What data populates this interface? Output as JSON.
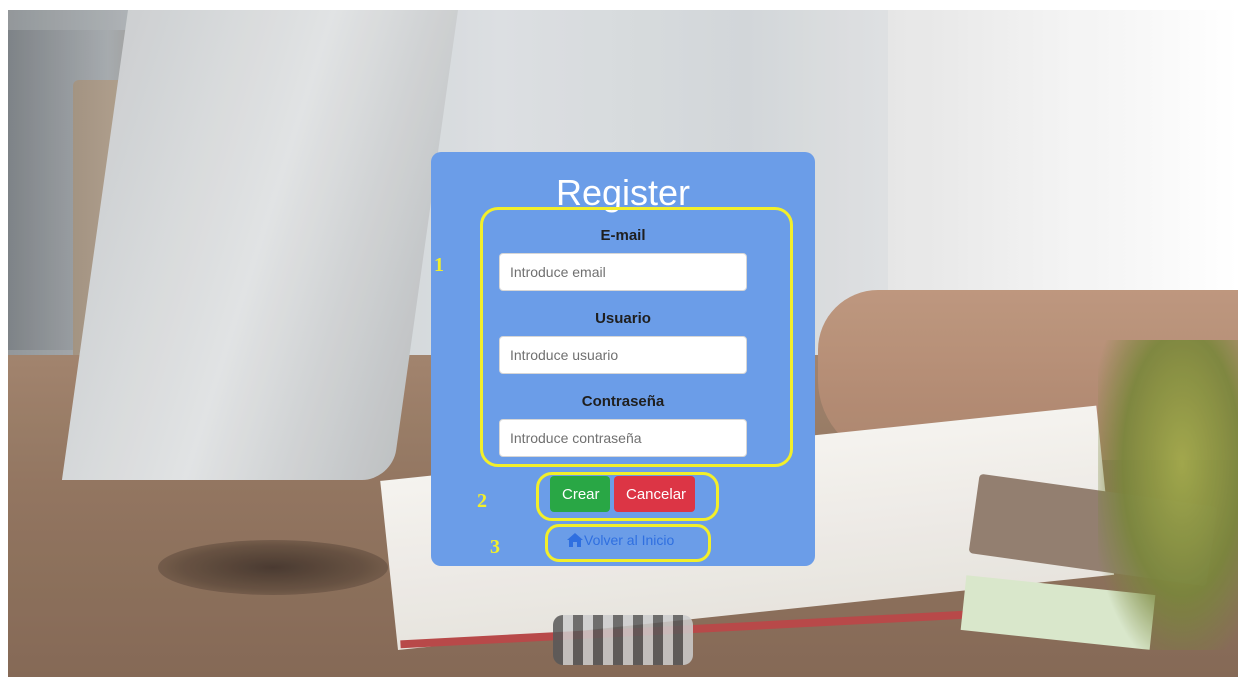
{
  "form": {
    "title": "Register",
    "email": {
      "label": "E-mail",
      "placeholder": "Introduce email",
      "value": ""
    },
    "user": {
      "label": "Usuario",
      "placeholder": "Introduce usuario",
      "value": ""
    },
    "password": {
      "label": "Contraseña",
      "placeholder": "Introduce contraseña",
      "value": ""
    },
    "buttons": {
      "create": "Crear",
      "cancel": "Cancelar"
    },
    "home_link": {
      "label": "Volver al Inicio",
      "icon": "home-icon"
    }
  },
  "annotations": {
    "markers": [
      "1",
      "2",
      "3"
    ],
    "color": "#f2ef2a"
  },
  "colors": {
    "card": "#6b9de8",
    "create_button": "#29a745",
    "cancel_button": "#dc3545",
    "link": "#2f6fe0"
  }
}
